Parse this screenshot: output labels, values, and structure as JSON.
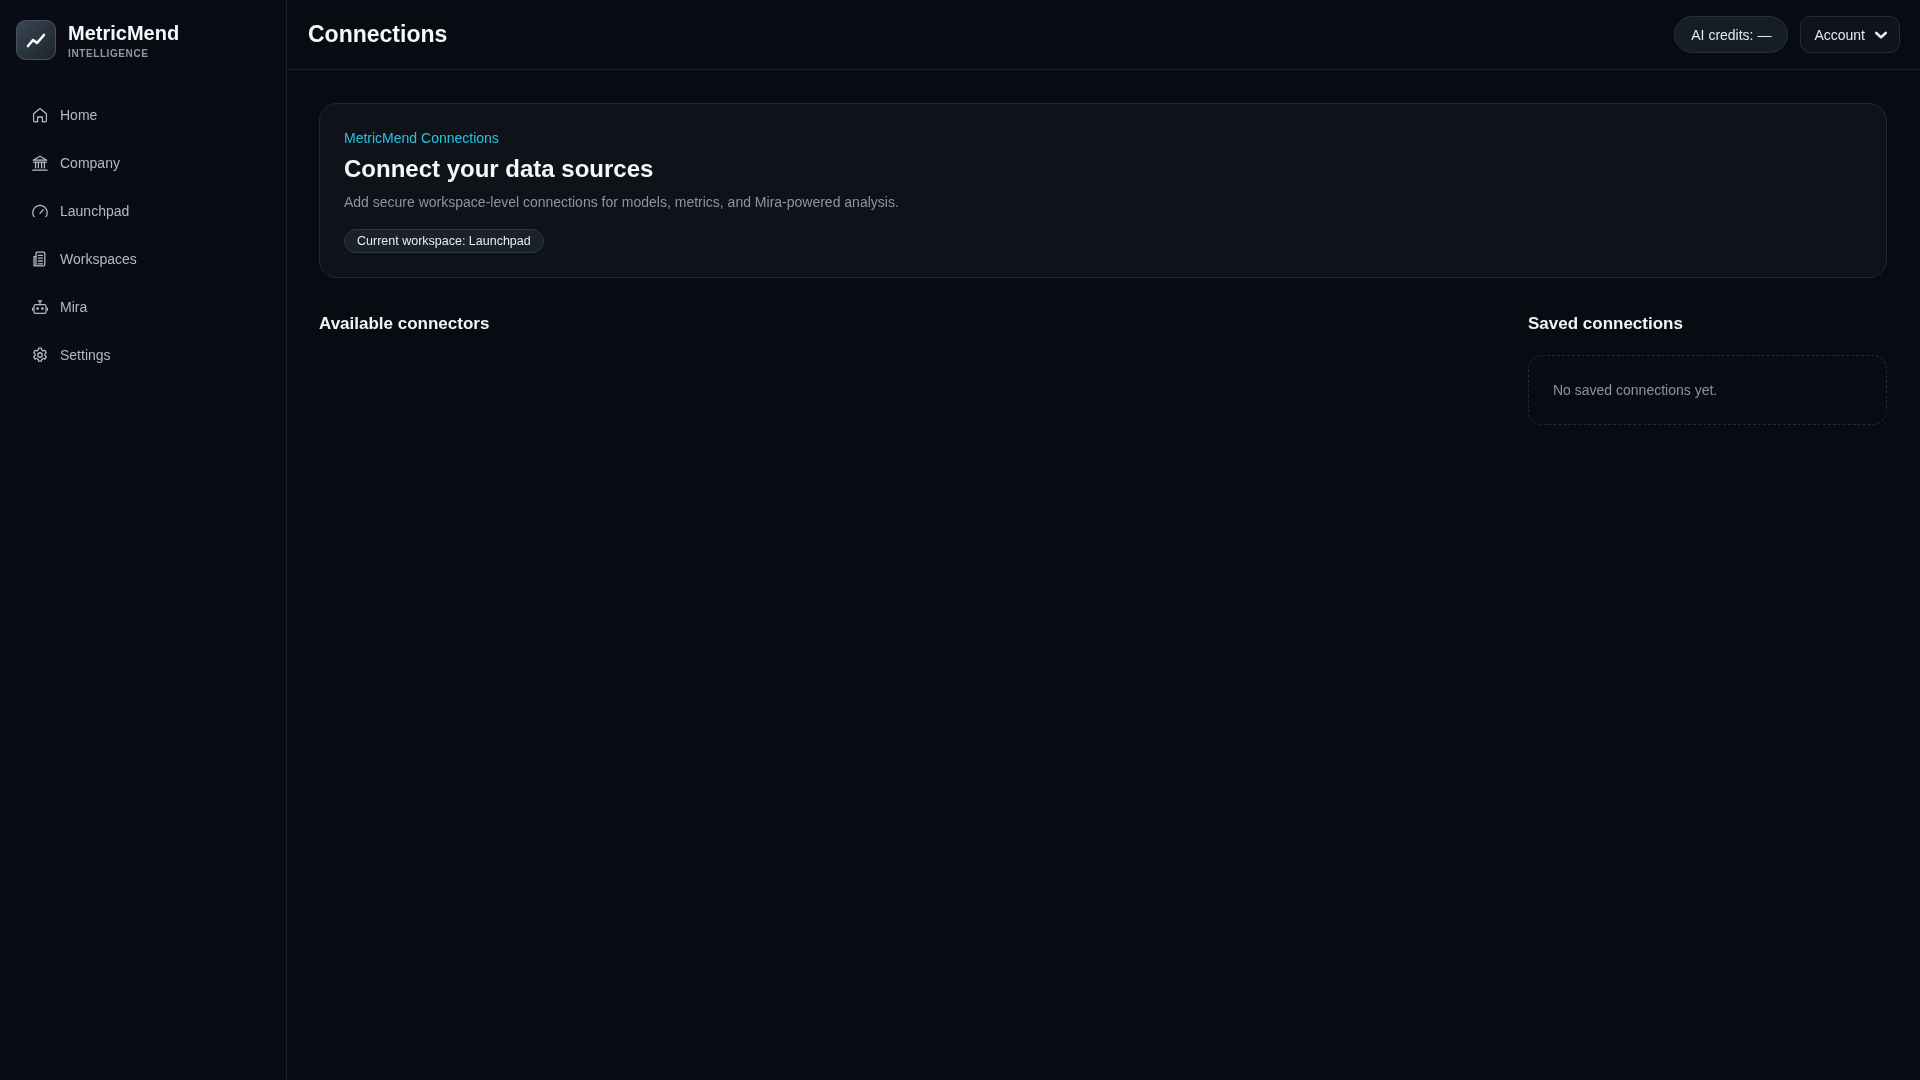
{
  "brand": {
    "name": "MetricMend",
    "tagline": "INTELLIGENCE"
  },
  "sidebar": {
    "items": [
      {
        "label": "Home",
        "selected": false
      },
      {
        "label": "Company",
        "selected": false
      },
      {
        "label": "Launchpad",
        "selected": false
      },
      {
        "label": "Workspaces",
        "selected": false
      },
      {
        "label": "Mira",
        "selected": false
      },
      {
        "label": "Settings",
        "selected": false
      }
    ]
  },
  "header": {
    "title": "Connections",
    "credits": "AI credits: —",
    "account": "Account"
  },
  "hero": {
    "eyebrow": "MetricMend Connections",
    "title": "Connect your data sources",
    "description": "Add secure workspace-level connections for models, metrics, and Mira-powered analysis.",
    "workspace_badge": "Current workspace: Launchpad"
  },
  "available": {
    "title": "Available connectors"
  },
  "saved": {
    "title": "Saved connections",
    "empty_message": "No saved connections yet."
  }
}
